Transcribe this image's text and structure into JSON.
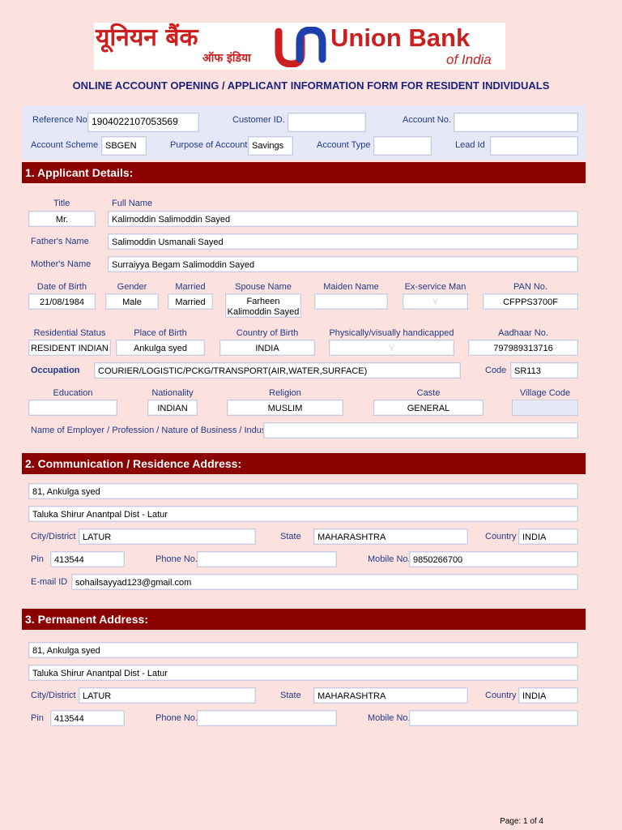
{
  "header": {
    "logo_hindi_line1": "यूनियन बैंक",
    "logo_hindi_line2": "ऑफ इंडिया",
    "logo_en_line1": "Union Bank",
    "logo_en_line2": "of India",
    "brand_color": "#cc1f1f",
    "form_title": "ONLINE ACCOUNT OPENING / APPLICANT INFORMATION FORM FOR RESIDENT INDIVIDUALS"
  },
  "account": {
    "reference_label": "Reference No.",
    "reference_value": "1904022107053569",
    "customer_id_label": "Customer ID.",
    "customer_id_value": "",
    "account_no_label": "Account No.",
    "account_no_value": "",
    "scheme_label": "Account Scheme",
    "scheme_value": "SBGEN",
    "purpose_label": "Purpose of Account",
    "purpose_value": "Savings",
    "type_label": "Account Type",
    "type_value": "",
    "lead_label": "Lead Id",
    "lead_value": ""
  },
  "section1": {
    "heading": "1. Applicant Details:",
    "title_label": "Title",
    "title_value": "Mr.",
    "fullname_label": "Full Name",
    "fullname_value": "Kalimoddin Salimoddin Sayed",
    "father_label": "Father's Name",
    "father_value": "Salimoddin Usmanali Sayed",
    "mother_label": "Mother's Name",
    "mother_value": "Surraiyya Begam Salimoddin Sayed",
    "dob_label": "Date of Birth",
    "dob_value": "21/08/1984",
    "gender_label": "Gender",
    "gender_value": "Male",
    "married_label": "Married",
    "married_value": "Married",
    "spouse_label": "Spouse Name",
    "spouse_value_line1": "Farheen",
    "spouse_value_line2": "Kalimoddin Sayed",
    "maiden_label": "Maiden Name",
    "maiden_value": "",
    "exservice_label": "Ex-service Man",
    "exservice_value": "Y",
    "pan_label": "PAN No.",
    "pan_value": "CFPPS3700F",
    "residential_label": "Residential Status",
    "residential_value": "RESIDENT INDIAN",
    "pob_label": "Place of Birth",
    "pob_value": "Ankulga syed",
    "cob_label": "Country of Birth",
    "cob_value": "INDIA",
    "handicap_label": "Physically/visually handicapped",
    "handicap_value": "Y",
    "aadhaar_label": "Aadhaar No.",
    "aadhaar_value": "797989313716",
    "occupation_label": "Occupation",
    "occupation_value": "COURIER/LOGISTIC/PCKG/TRANSPORT(AIR,WATER,SURFACE)",
    "code_label": "Code",
    "code_value": "SR113",
    "education_label": "Education",
    "education_value": "",
    "nationality_label": "Nationality",
    "nationality_value": "INDIAN",
    "religion_label": "Religion",
    "religion_value": "MUSLIM",
    "caste_label": "Caste",
    "caste_value": "GENERAL",
    "village_label": "Village Code",
    "village_value": "",
    "employer_label": "Name of Employer / Profession / Nature of Business / Industry",
    "employer_value": ""
  },
  "section2": {
    "heading": "2. Communication / Residence Address:",
    "line1": "81, Ankulga syed",
    "line2": "Taluka Shirur Anantpal Dist - Latur",
    "city_label": "City/District",
    "city_value": "LATUR",
    "state_label": "State",
    "state_value": "MAHARASHTRA",
    "country_label": "Country",
    "country_value": "INDIA",
    "pin_label": "Pin",
    "pin_value": "413544",
    "phone_label": "Phone No.",
    "phone_value": "",
    "mobile_label": "Mobile No.",
    "mobile_value": "9850266700",
    "email_label": "E-mail ID",
    "email_value": "sohailsayyad123@gmail.com"
  },
  "section3": {
    "heading": "3. Permanent Address:",
    "line1": "81, Ankulga syed",
    "line2": "Taluka Shirur Anantpal Dist - Latur",
    "city_label": "City/District",
    "city_value": "LATUR",
    "state_label": "State",
    "state_value": "MAHARASHTRA",
    "country_label": "Country",
    "country_value": "INDIA",
    "pin_label": "Pin",
    "pin_value": "413544",
    "phone_label": "Phone No.",
    "phone_value": "",
    "mobile_label": "Mobile No.",
    "mobile_value": ""
  },
  "footer": {
    "page": "Page: 1 of 4"
  },
  "colors": {
    "page_bg": "#fde1de",
    "section_bg": "#8b0000",
    "label": "#1e3a8a",
    "title": "#1a237e",
    "band": "#e6e8f8"
  }
}
